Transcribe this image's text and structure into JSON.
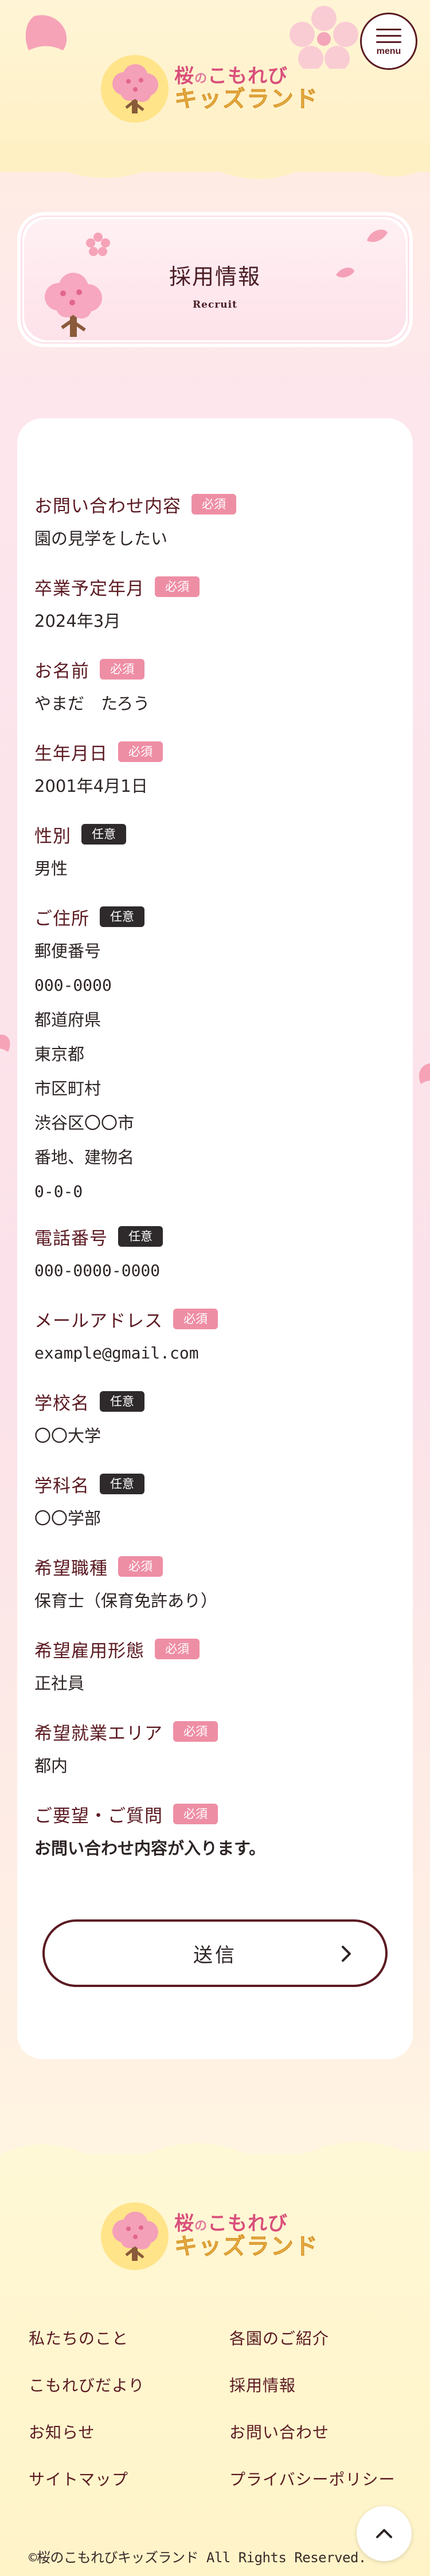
{
  "header": {
    "logo": {
      "line1_a": "桜",
      "line1_b": "の",
      "line1_c": "こもれび",
      "line2": "キッズランド"
    },
    "menu_label": "menu"
  },
  "page_title": {
    "jp": "採用情報",
    "en": "Recruit"
  },
  "badges": {
    "required": "必須",
    "optional": "任意"
  },
  "form": {
    "fields": [
      {
        "label": "お問い合わせ内容",
        "badge": "required",
        "value": "園の見学をしたい"
      },
      {
        "label": "卒業予定年月",
        "badge": "required",
        "value": "2024年3月"
      },
      {
        "label": "お名前",
        "badge": "required",
        "value": "やまだ　たろう"
      },
      {
        "label": "生年月日",
        "badge": "required",
        "value": "2001年4月1日"
      },
      {
        "label": "性別",
        "badge": "optional",
        "value": "男性"
      },
      {
        "label": "ご住所",
        "badge": "optional",
        "lines": [
          "郵便番号",
          "000-0000",
          "都道府県",
          "東京都",
          "市区町村",
          "渋谷区〇〇市",
          "番地、建物名",
          "0-0-0"
        ]
      },
      {
        "label": "電話番号",
        "badge": "optional",
        "value": "000-0000-0000"
      },
      {
        "label": "メールアドレス",
        "badge": "required",
        "value": "example@gmail.com"
      },
      {
        "label": "学校名",
        "badge": "optional",
        "value": "〇〇大学"
      },
      {
        "label": "学科名",
        "badge": "optional",
        "value": "〇〇学部"
      },
      {
        "label": "希望職種",
        "badge": "required",
        "value": "保育士（保育免許あり）"
      },
      {
        "label": "希望雇用形態",
        "badge": "required",
        "value": "正社員"
      },
      {
        "label": "希望就業エリア",
        "badge": "required",
        "value": "都内"
      },
      {
        "label": "ご要望・ご質問",
        "badge": "required",
        "value": "お問い合わせ内容が入ります。"
      }
    ],
    "submit_label": "送信"
  },
  "footer": {
    "nav": [
      "私たちのこと",
      "各園のご紹介",
      "こもれびだより",
      "採用情報",
      "お知らせ",
      "お問い合わせ",
      "サイトマップ",
      "プライバシーポリシー"
    ],
    "copyright": "©桜のこもれびキッズランド All Rights Reserved."
  },
  "colors": {
    "accent": "#5b1a22",
    "required_badge": "#ee8ea5",
    "optional_badge": "#2e2a2b",
    "logo_pink": "#d94f7b",
    "logo_gold": "#e7b24a"
  },
  "icons": [
    "menu-icon",
    "chevron-right-icon",
    "chevron-up-icon",
    "sakura-tree-icon",
    "sakura-petal-icon"
  ]
}
